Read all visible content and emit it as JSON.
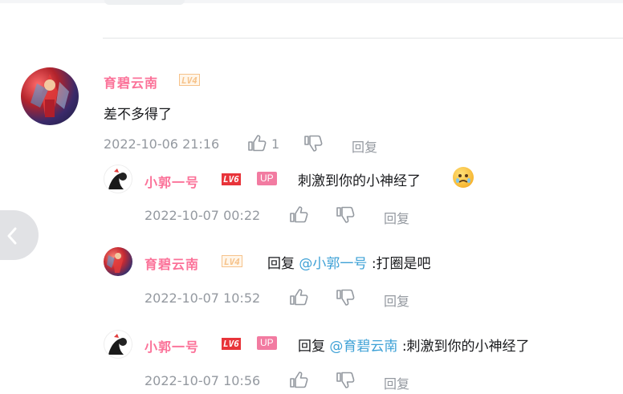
{
  "comment": {
    "username": "育碧云南",
    "level": "LV4",
    "text": "差不多得了",
    "time": "2022-10-06 21:16",
    "likes": "1",
    "reply_label": "回复"
  },
  "replies": [
    {
      "username": "小郭一号",
      "level": "LV6",
      "badge": "UP",
      "text": "刺激到你的小神经了",
      "emoji": "crying-face-emoji",
      "time": "2022-10-07 00:22",
      "reply_label": "回复"
    },
    {
      "username": "育碧云南",
      "level": "LV4",
      "prefix": "回复",
      "mention": "@小郭一号",
      "text": ":打圈是吧",
      "time": "2022-10-07 10:52",
      "reply_label": "回复"
    },
    {
      "username": "小郭一号",
      "level": "LV6",
      "badge": "UP",
      "prefix": "回复",
      "mention": "@育碧云南",
      "text": ":刺激到你的小神经了",
      "time": "2022-10-07 10:56",
      "reply_label": "回复"
    }
  ],
  "icons": {
    "like": "thumbs-up-icon",
    "dislike": "thumbs-down-icon",
    "nav": "chevron-left-icon"
  },
  "colors": {
    "username": "#fb7299",
    "mention": "#3ea1d6",
    "meta": "#9499a0",
    "level6": "#e8343a",
    "level4": "#f6c28a",
    "up_badge": "#f27ba1"
  }
}
